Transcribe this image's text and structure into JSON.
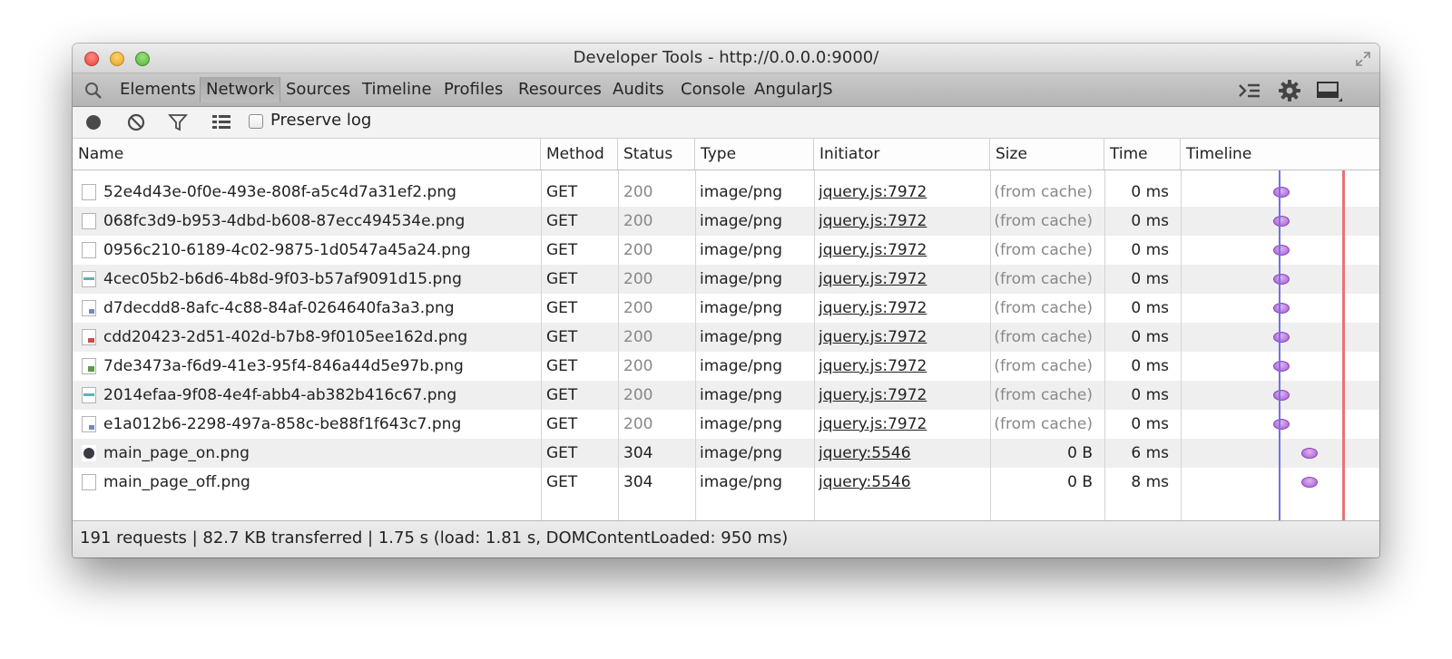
{
  "window": {
    "title": "Developer Tools - http://0.0.0.0:9000/"
  },
  "tabs": [
    {
      "label": "Elements",
      "selected": false
    },
    {
      "label": "Network",
      "selected": true
    },
    {
      "label": "Sources",
      "selected": false
    },
    {
      "label": "Timeline",
      "selected": false
    },
    {
      "label": "Profiles",
      "selected": false
    },
    {
      "label": "Resources",
      "selected": false
    },
    {
      "label": "Audits",
      "selected": false
    },
    {
      "label": "Console",
      "selected": false
    },
    {
      "label": "AngularJS",
      "selected": false
    }
  ],
  "toolbar": {
    "preserve_log_label": "Preserve log",
    "preserve_log_checked": false
  },
  "columns": [
    "Name",
    "Method",
    "Status",
    "Type",
    "Initiator",
    "Size",
    "Time",
    "Timeline"
  ],
  "rows": [
    {
      "name": "52e4d43e-0f0e-493e-808f-a5c4d7a31ef2.png",
      "method": "GET",
      "status": "200",
      "type": "image/png",
      "initiator": "jquery.js:7972",
      "size": "(from cache)",
      "time": "0 ms",
      "icon": "file-icon"
    },
    {
      "name": "068fc3d9-b953-4dbd-b608-87ecc494534e.png",
      "method": "GET",
      "status": "200",
      "type": "image/png",
      "initiator": "jquery.js:7972",
      "size": "(from cache)",
      "time": "0 ms",
      "icon": "file-icon"
    },
    {
      "name": "0956c210-6189-4c02-9875-1d0547a45a24.png",
      "method": "GET",
      "status": "200",
      "type": "image/png",
      "initiator": "jquery.js:7972",
      "size": "(from cache)",
      "time": "0 ms",
      "icon": "file-icon"
    },
    {
      "name": "4cec05b2-b6d6-4b8d-9f03-b57af9091d15.png",
      "method": "GET",
      "status": "200",
      "type": "image/png",
      "initiator": "jquery.js:7972",
      "size": "(from cache)",
      "time": "0 ms",
      "icon": "image-thumbnail-icon"
    },
    {
      "name": "d7decdd8-8afc-4c88-84af-0264640fa3a3.png",
      "method": "GET",
      "status": "200",
      "type": "image/png",
      "initiator": "jquery.js:7972",
      "size": "(from cache)",
      "time": "0 ms",
      "icon": "image-thumbnail-icon"
    },
    {
      "name": "cdd20423-2d51-402d-b7b8-9f0105ee162d.png",
      "method": "GET",
      "status": "200",
      "type": "image/png",
      "initiator": "jquery.js:7972",
      "size": "(from cache)",
      "time": "0 ms",
      "icon": "image-thumbnail-icon"
    },
    {
      "name": "7de3473a-f6d9-41e3-95f4-846a44d5e97b.png",
      "method": "GET",
      "status": "200",
      "type": "image/png",
      "initiator": "jquery.js:7972",
      "size": "(from cache)",
      "time": "0 ms",
      "icon": "image-thumbnail-icon"
    },
    {
      "name": "2014efaa-9f08-4e4f-abb4-ab382b416c67.png",
      "method": "GET",
      "status": "200",
      "type": "image/png",
      "initiator": "jquery.js:7972",
      "size": "(from cache)",
      "time": "0 ms",
      "icon": "image-thumbnail-icon"
    },
    {
      "name": "e1a012b6-2298-497a-858c-be88f1f643c7.png",
      "method": "GET",
      "status": "200",
      "type": "image/png",
      "initiator": "jquery.js:7972",
      "size": "(from cache)",
      "time": "0 ms",
      "icon": "image-thumbnail-icon"
    },
    {
      "name": "main_page_on.png",
      "method": "GET",
      "status": "304",
      "type": "image/png",
      "initiator": "jquery:5546",
      "size": "0 B",
      "time": "6 ms",
      "icon": "dark-circle-icon"
    },
    {
      "name": "main_page_off.png",
      "method": "GET",
      "status": "304",
      "type": "image/png",
      "initiator": "jquery:5546",
      "size": "0 B",
      "time": "8 ms",
      "icon": "blank-file-icon"
    }
  ],
  "status_bar": {
    "summary": "191 requests | 82.7 KB transferred | 1.75 s (load: 1.81 s, DOMContentLoaded: 950 ms)"
  },
  "colors": {
    "dom_content_loaded_line": "#6f72e8",
    "load_line": "#e87379",
    "waterfall_bar": "#b26fe0"
  }
}
